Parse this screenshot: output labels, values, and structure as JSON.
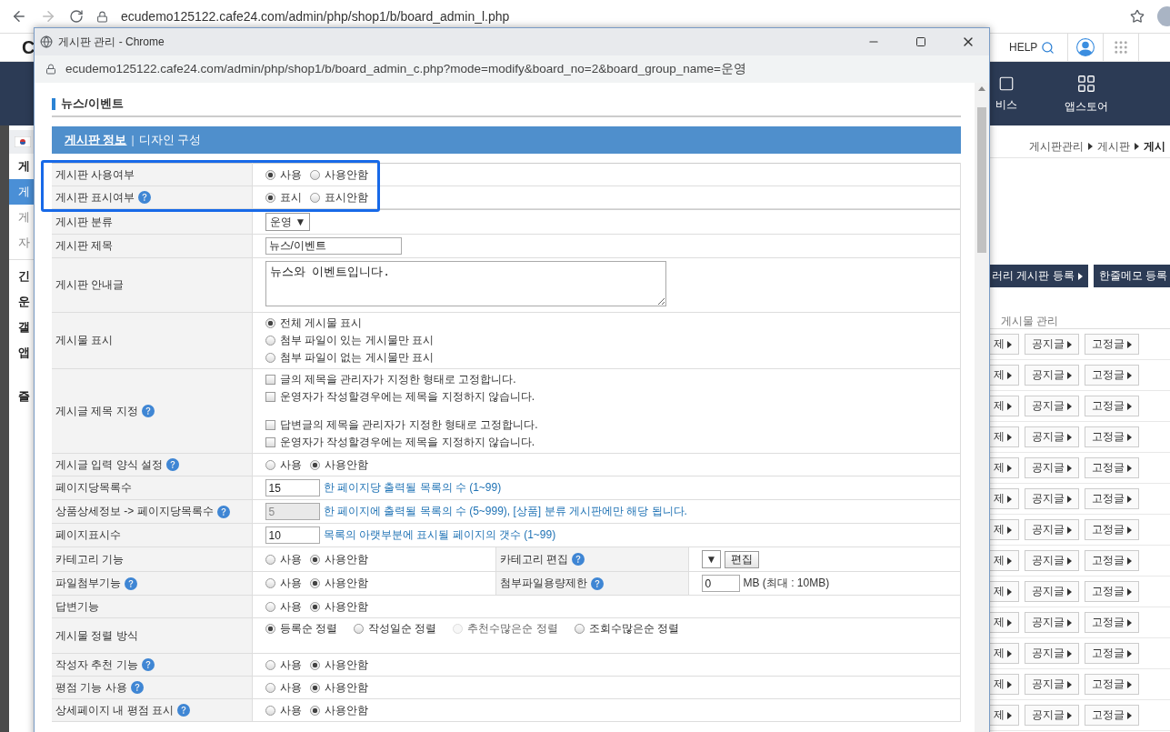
{
  "browser": {
    "url": "ecudemo125122.cafe24.com/admin/php/shop1/b/board_admin_l.php"
  },
  "page": {
    "logo": "C",
    "help": "HELP",
    "nav": [
      {
        "label": "비스"
      },
      {
        "label": "앱스토어"
      }
    ],
    "sidebar": [
      {
        "kind": "heading",
        "label": "게",
        "selected": false
      },
      {
        "kind": "item",
        "label": "게",
        "selected": true
      },
      {
        "kind": "item",
        "label": "게",
        "selected": false
      },
      {
        "kind": "item",
        "label": "자",
        "selected": false
      },
      {
        "kind": "divider"
      },
      {
        "kind": "heading",
        "label": "긴",
        "selected": false
      },
      {
        "kind": "heading",
        "label": "운",
        "selected": false
      },
      {
        "kind": "heading",
        "label": "갤",
        "selected": false
      },
      {
        "kind": "heading",
        "label": "앱",
        "selected": false
      },
      {
        "kind": "spacer"
      },
      {
        "kind": "heading",
        "label": "즐",
        "selected": false
      }
    ],
    "breadcrumb": [
      "게시판관리",
      "게시판",
      "게시"
    ],
    "action_buttons": [
      {
        "label": "러리 게시판 등록",
        "caret": true
      },
      {
        "label": "한줄메모 등록",
        "caret": false
      }
    ],
    "section_title": "게시물 관리",
    "post_rows": [
      {
        "buttons": [
          "제",
          "공지글",
          "고정글"
        ]
      },
      {
        "buttons": [
          "제",
          "공지글",
          "고정글"
        ]
      },
      {
        "buttons": [
          "제",
          "공지글",
          "고정글"
        ]
      },
      {
        "buttons": [
          "제",
          "공지글",
          "고정글"
        ]
      },
      {
        "buttons": [
          "제",
          "공지글",
          "고정글"
        ]
      },
      {
        "buttons": [
          "제",
          "공지글",
          "고정글"
        ]
      },
      {
        "buttons": [
          "제",
          "공지글",
          "고정글"
        ]
      },
      {
        "buttons": [
          "제",
          "공지글",
          "고정글"
        ]
      },
      {
        "buttons": [
          "제",
          "공지글",
          "고정글"
        ]
      },
      {
        "buttons": [
          "제",
          "공지글",
          "고정글"
        ]
      },
      {
        "buttons": [
          "제",
          "공지글",
          "고정글"
        ]
      },
      {
        "buttons": [
          "제",
          "공지글",
          "고정글"
        ]
      },
      {
        "buttons": [
          "제",
          "공지글",
          "고정글"
        ]
      }
    ]
  },
  "popup": {
    "title": "게시판 관리 - Chrome",
    "url": "ecudemo125122.cafe24.com/admin/php/shop1/b/board_admin_c.php?mode=modify&board_no=2&board_group_name=운영",
    "heading": "뉴스/이벤트",
    "tabs": [
      {
        "label": "게시판 정보",
        "selected": true
      },
      {
        "label": "디자인 구성",
        "selected": false
      }
    ],
    "tab_separator": "|",
    "rows": [
      {
        "label": "게시판 사용여부",
        "help": false,
        "highlighted": true,
        "control": {
          "kind": "radios",
          "options": [
            {
              "label": "사용",
              "selected": true
            },
            {
              "label": "사용안함",
              "selected": false
            }
          ]
        }
      },
      {
        "label": "게시판 표시여부",
        "help": true,
        "highlighted": true,
        "control": {
          "kind": "radios",
          "options": [
            {
              "label": "표시",
              "selected": true
            },
            {
              "label": "표시안함",
              "selected": false
            }
          ]
        }
      },
      {
        "label": "게시판 분류",
        "help": false,
        "highlighted": false,
        "control": {
          "kind": "select",
          "value": "운영",
          "arrow": "▼"
        }
      },
      {
        "label": "게시판 제목",
        "help": false,
        "highlighted": false,
        "control": {
          "kind": "text",
          "value": "뉴스/이벤트"
        }
      },
      {
        "label": "게시판 안내글",
        "help": false,
        "highlighted": false,
        "control": {
          "kind": "textarea",
          "value": "뉴스와 이벤트입니다."
        }
      },
      {
        "label": "게시물 표시",
        "help": false,
        "highlighted": false,
        "control": {
          "kind": "radio_column",
          "options": [
            {
              "label": "전체 게시물 표시",
              "selected": true
            },
            {
              "label": "첨부 파일이 있는 게시물만 표시",
              "selected": false
            },
            {
              "label": "첨부 파일이 없는 게시물만 표시",
              "selected": false
            }
          ]
        }
      },
      {
        "label": "게시글 제목 지정",
        "help": true,
        "highlighted": false,
        "control": {
          "kind": "checkboxes",
          "groups": [
            [
              {
                "label": "글의 제목을 관리자가 지정한 형태로 고정합니다.",
                "checked": false
              },
              {
                "label": "운영자가 작성할경우에는 제목을 지정하지 않습니다.",
                "checked": false
              }
            ],
            [
              {
                "label": "답변글의 제목을 관리자가 지정한 형태로 고정합니다.",
                "checked": false
              },
              {
                "label": "운영자가 작성할경우에는 제목을 지정하지 않습니다.",
                "checked": false
              }
            ]
          ]
        }
      },
      {
        "label": "게시글 입력 양식 설정",
        "help": true,
        "highlighted": false,
        "control": {
          "kind": "radios",
          "options": [
            {
              "label": "사용",
              "selected": false
            },
            {
              "label": "사용안함",
              "selected": true
            }
          ]
        }
      },
      {
        "label": "페이지당목록수",
        "help": false,
        "highlighted": false,
        "control": {
          "kind": "number",
          "value": "15",
          "disabled": false,
          "hint": "한 페이지당 출력될 목록의 수 (1~99)"
        }
      },
      {
        "label": "상품상세정보 -> 페이지당목록수",
        "help": true,
        "highlighted": false,
        "control": {
          "kind": "number",
          "value": "5",
          "disabled": true,
          "hint": "한 페이지에 출력될 목록의 수 (5~999), [상품] 분류 게시판에만 해당 됩니다."
        }
      },
      {
        "label": "페이지표시수",
        "help": false,
        "highlighted": false,
        "control": {
          "kind": "number",
          "value": "10",
          "disabled": false,
          "hint": "목록의 아랫부분에 표시될 페이지의 갯수 (1~99)"
        }
      },
      {
        "label": "카테고리 기능",
        "help": false,
        "highlighted": false,
        "control": {
          "kind": "radios",
          "options": [
            {
              "label": "사용",
              "selected": false
            },
            {
              "label": "사용안함",
              "selected": true
            }
          ]
        },
        "extra": {
          "label": "카테고리 편집",
          "help": true,
          "control": {
            "kind": "select_button",
            "arrow": "▼",
            "button": "편집"
          }
        }
      },
      {
        "label": "파일첨부기능",
        "help": true,
        "highlighted": false,
        "control": {
          "kind": "radios",
          "options": [
            {
              "label": "사용",
              "selected": false
            },
            {
              "label": "사용안함",
              "selected": true
            }
          ]
        },
        "extra": {
          "label": "첨부파일용량제한",
          "help": true,
          "control": {
            "kind": "unit",
            "value": "0",
            "unit": "MB (최대 : 10MB)"
          }
        }
      },
      {
        "label": "답변기능",
        "help": false,
        "highlighted": false,
        "control": {
          "kind": "radios",
          "options": [
            {
              "label": "사용",
              "selected": false
            },
            {
              "label": "사용안함",
              "selected": true
            }
          ]
        }
      },
      {
        "label": "게시물 정렬 방식",
        "help": false,
        "highlighted": false,
        "control": {
          "kind": "radios_wide",
          "options": [
            {
              "label": "등록순 정렬",
              "selected": true,
              "disabled": false
            },
            {
              "label": "작성일순 정렬",
              "selected": false,
              "disabled": false
            },
            {
              "label": "추천수많은순 정렬",
              "selected": false,
              "disabled": true
            },
            {
              "label": "조회수많은순 정렬",
              "selected": false,
              "disabled": false
            }
          ]
        }
      },
      {
        "label": "작성자 추천 기능",
        "help": true,
        "highlighted": false,
        "control": {
          "kind": "radios",
          "options": [
            {
              "label": "사용",
              "selected": false
            },
            {
              "label": "사용안함",
              "selected": true
            }
          ]
        }
      },
      {
        "label": "평점 기능 사용",
        "help": true,
        "highlighted": false,
        "control": {
          "kind": "radios",
          "options": [
            {
              "label": "사용",
              "selected": false
            },
            {
              "label": "사용안함",
              "selected": true
            }
          ]
        }
      },
      {
        "label": "상세페이지 내 평점 표시",
        "help": true,
        "highlighted": false,
        "control": {
          "kind": "radios",
          "options": [
            {
              "label": "사용",
              "selected": false
            },
            {
              "label": "사용안함",
              "selected": true
            }
          ]
        }
      }
    ]
  }
}
